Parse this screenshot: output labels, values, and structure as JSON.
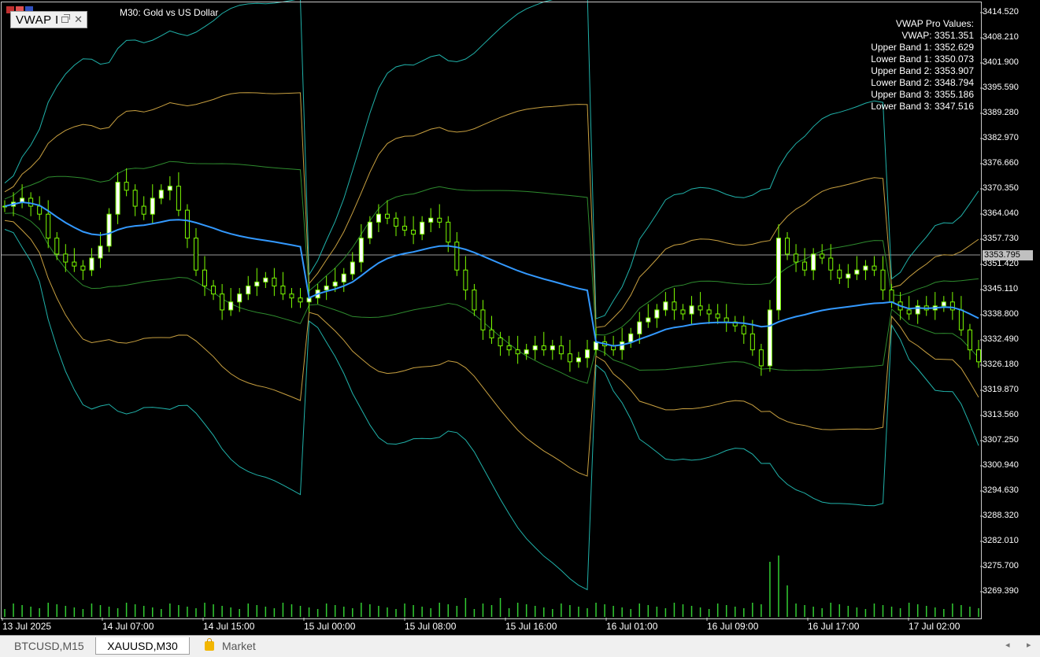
{
  "chart": {
    "title": "M30:  Gold vs US Dollar",
    "indicator_label": "VWAP I",
    "values_panel": {
      "heading": "VWAP Pro Values:",
      "lines": [
        "VWAP: 3351.351",
        "Upper Band 1: 3352.629",
        "Lower Band 1: 3350.073",
        "Upper Band 2: 3353.907",
        "Lower Band 2: 3348.794",
        "Upper Band 3: 3355.186",
        "Lower Band 3: 3347.516"
      ]
    },
    "price_axis": [
      "3414.520",
      "3408.210",
      "3401.900",
      "3395.590",
      "3389.280",
      "3382.970",
      "3376.660",
      "3370.350",
      "3364.040",
      "3357.730",
      "3351.420",
      "3345.110",
      "3338.800",
      "3332.490",
      "3326.180",
      "3319.870",
      "3313.560",
      "3307.250",
      "3300.940",
      "3294.630",
      "3288.320",
      "3282.010",
      "3275.700",
      "3269.390"
    ],
    "current_price": "3353.795",
    "time_axis": [
      "13 Jul 2025",
      "14 Jul 07:00",
      "14 Jul 15:00",
      "15 Jul 00:00",
      "15 Jul 08:00",
      "15 Jul 16:00",
      "16 Jul 01:00",
      "16 Jul 09:00",
      "16 Jul 17:00",
      "17 Jul 02:00"
    ],
    "colors": {
      "background": "#000000",
      "candle_bull": "#ffffff",
      "candle_bear": "#7cfc00",
      "wick": "#7cfc00",
      "vwap": "#3399ff",
      "band1": "#2e8b2e",
      "band2": "#c8a040",
      "band3": "#20b2aa",
      "volume": "#32cd32"
    }
  },
  "tabs": {
    "items": [
      "BTCUSD,M15",
      "XAUUSD,M30",
      "Market"
    ],
    "active": "XAUUSD,M30",
    "left_arrow": "◂",
    "right_arrow": "▸"
  },
  "chart_data": {
    "type": "candlestick",
    "symbol": "XAUUSD",
    "timeframe": "M30",
    "ylim": [
      3265,
      3417
    ],
    "grid": false,
    "sessions": [
      {
        "start": "13 Jul 2025",
        "open": 3364.0,
        "vwap_end": 3358.5,
        "band3_width_end": 24
      },
      {
        "start": "15 Jul 00:00",
        "open": 3347.0,
        "vwap_end": 3346.0,
        "band3_width_end": 36
      },
      {
        "start": "16 Jul 01:00",
        "open": 3331.0,
        "vwap_end": 3344.5,
        "band3_width_end": 32
      },
      {
        "start": "17 Jul 02:00",
        "open": 3345.0,
        "vwap_end": 3338.0,
        "band3_width_end": 8
      }
    ],
    "close_path": [
      3366,
      3367,
      3368,
      3366,
      3364,
      3358,
      3354,
      3352,
      3351,
      3350,
      3353,
      3356,
      3364,
      3372,
      3370,
      3366,
      3364,
      3368,
      3370,
      3371,
      3365,
      3358,
      3350,
      3346,
      3344,
      3340,
      3342,
      3344,
      3346,
      3347,
      3348,
      3346,
      3344,
      3343,
      3342,
      3343,
      3345,
      3346,
      3347,
      3349,
      3352,
      3358,
      3362,
      3364,
      3363,
      3361,
      3360,
      3359,
      3362,
      3363,
      3362,
      3357,
      3350,
      3345,
      3340,
      3335,
      3333,
      3331,
      3330,
      3329,
      3330,
      3331,
      3330,
      3331,
      3329,
      3327,
      3328,
      3330,
      3332,
      3331,
      3330,
      3332,
      3334,
      3337,
      3338,
      3340,
      3342,
      3340,
      3339,
      3341,
      3340,
      3339,
      3338,
      3337,
      3336,
      3334,
      3330,
      3326,
      3340,
      3358,
      3354,
      3352,
      3350,
      3354,
      3353,
      3350,
      3348,
      3349,
      3350,
      3351,
      3350,
      3345,
      3342,
      3340,
      3339,
      3341,
      3340,
      3341,
      3342,
      3340,
      3335,
      3330,
      3327
    ]
  }
}
